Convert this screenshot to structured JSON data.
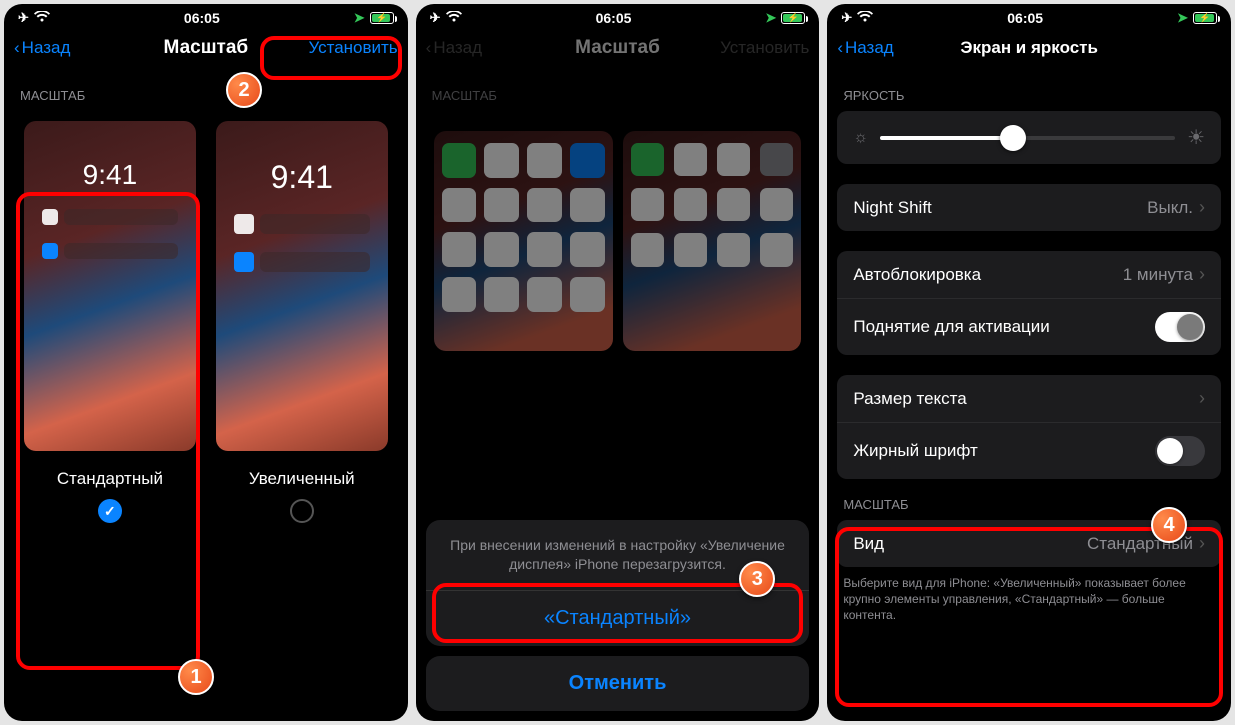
{
  "statusbar": {
    "time": "06:05"
  },
  "screen1": {
    "back": "Назад",
    "title": "Масштаб",
    "action": "Установить",
    "section": "МАСШТАБ",
    "preview_time": "9:41",
    "option_standard": "Стандартный",
    "option_zoomed": "Увеличенный",
    "step": "1",
    "step2": "2"
  },
  "screen2": {
    "back": "Назад",
    "title": "Масштаб",
    "action": "Установить",
    "section": "МАСШТАБ",
    "sheet_msg": "При внесении изменений в настройку «Увеличение дисплея» iPhone перезагрузится.",
    "sheet_confirm": "«Стандартный»",
    "sheet_cancel": "Отменить",
    "step": "3"
  },
  "screen3": {
    "back": "Назад",
    "title": "Экран и яркость",
    "brightness_header": "ЯРКОСТЬ",
    "night_shift": "Night Shift",
    "night_shift_value": "Выкл.",
    "autolock": "Автоблокировка",
    "autolock_value": "1 минута",
    "raise_to_wake": "Поднятие для активации",
    "text_size": "Размер текста",
    "bold_text": "Жирный шрифт",
    "zoom_header": "МАСШТАБ",
    "view": "Вид",
    "view_value": "Стандартный",
    "footer": "Выберите вид для iPhone: «Увеличенный» показывает более крупно элементы управления, «Стандартный» — больше контента.",
    "step": "4"
  }
}
